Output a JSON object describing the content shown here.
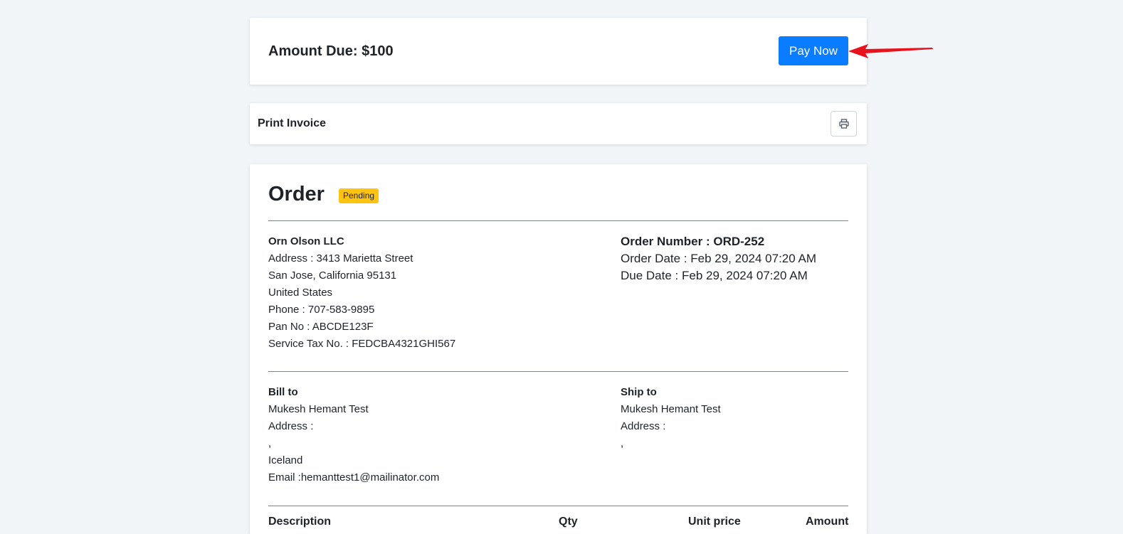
{
  "amount_card": {
    "title": "Amount Due: $100",
    "pay_label": "Pay Now"
  },
  "print_card": {
    "label": "Print Invoice",
    "icon": "printer-icon"
  },
  "order": {
    "title": "Order",
    "status": "Pending",
    "status_color": "#ffc312",
    "company": {
      "name": "Orn Olson LLC",
      "address": "Address : 3413 Marietta Street",
      "city": "San Jose, California 95131",
      "country": "United States",
      "phone": "Phone : 707-583-9895",
      "pan": "Pan No : ABCDE123F",
      "service_tax": "Service Tax No. : FEDCBA4321GHI567"
    },
    "meta": {
      "number": "Order Number : ORD-252",
      "order_date": "Order Date : Feb 29, 2024 07:20 AM",
      "due_date": "Due Date : Feb 29, 2024 07:20 AM"
    },
    "bill_to": {
      "heading": "Bill to",
      "name": "Mukesh Hemant Test",
      "address": "Address :",
      "line": ",",
      "country": "Iceland",
      "email": "Email :hemanttest1@mailinator.com"
    },
    "ship_to": {
      "heading": "Ship to",
      "name": "Mukesh Hemant Test",
      "address": "Address :",
      "line": ","
    },
    "table_headers": [
      "Description",
      "Qty",
      "Unit price",
      "Amount"
    ]
  },
  "colors": {
    "accent": "#0a7cff",
    "arrow": "#e8121c",
    "background": "#f2f5f8"
  }
}
